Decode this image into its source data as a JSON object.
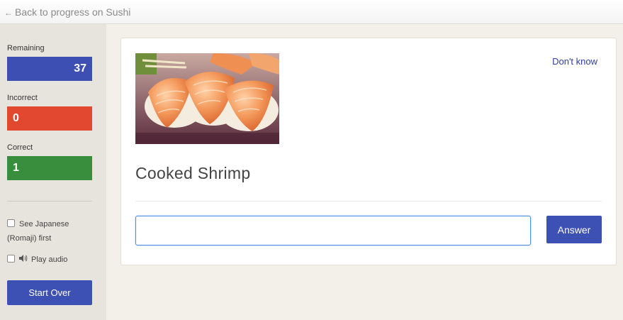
{
  "topbar": {
    "back_arrow": "←",
    "back_label": "Back to progress on Sushi"
  },
  "sidebar": {
    "remaining_label": "Remaining",
    "remaining_value": "37",
    "incorrect_label": "Incorrect",
    "incorrect_value": "0",
    "correct_label": "Correct",
    "correct_value": "1",
    "option_japanese_line1": "See Japanese",
    "option_japanese_line2": "(Romaji) first",
    "option_audio": "Play audio",
    "start_over": "Start Over"
  },
  "card": {
    "dont_know": "Don't know",
    "prompt": "Cooked Shrimp",
    "answer_value": "",
    "answer_button": "Answer"
  },
  "colors": {
    "remaining": "#3d4fb3",
    "incorrect": "#e2482f",
    "correct": "#388e3c",
    "primary_button": "#3d51b5"
  }
}
